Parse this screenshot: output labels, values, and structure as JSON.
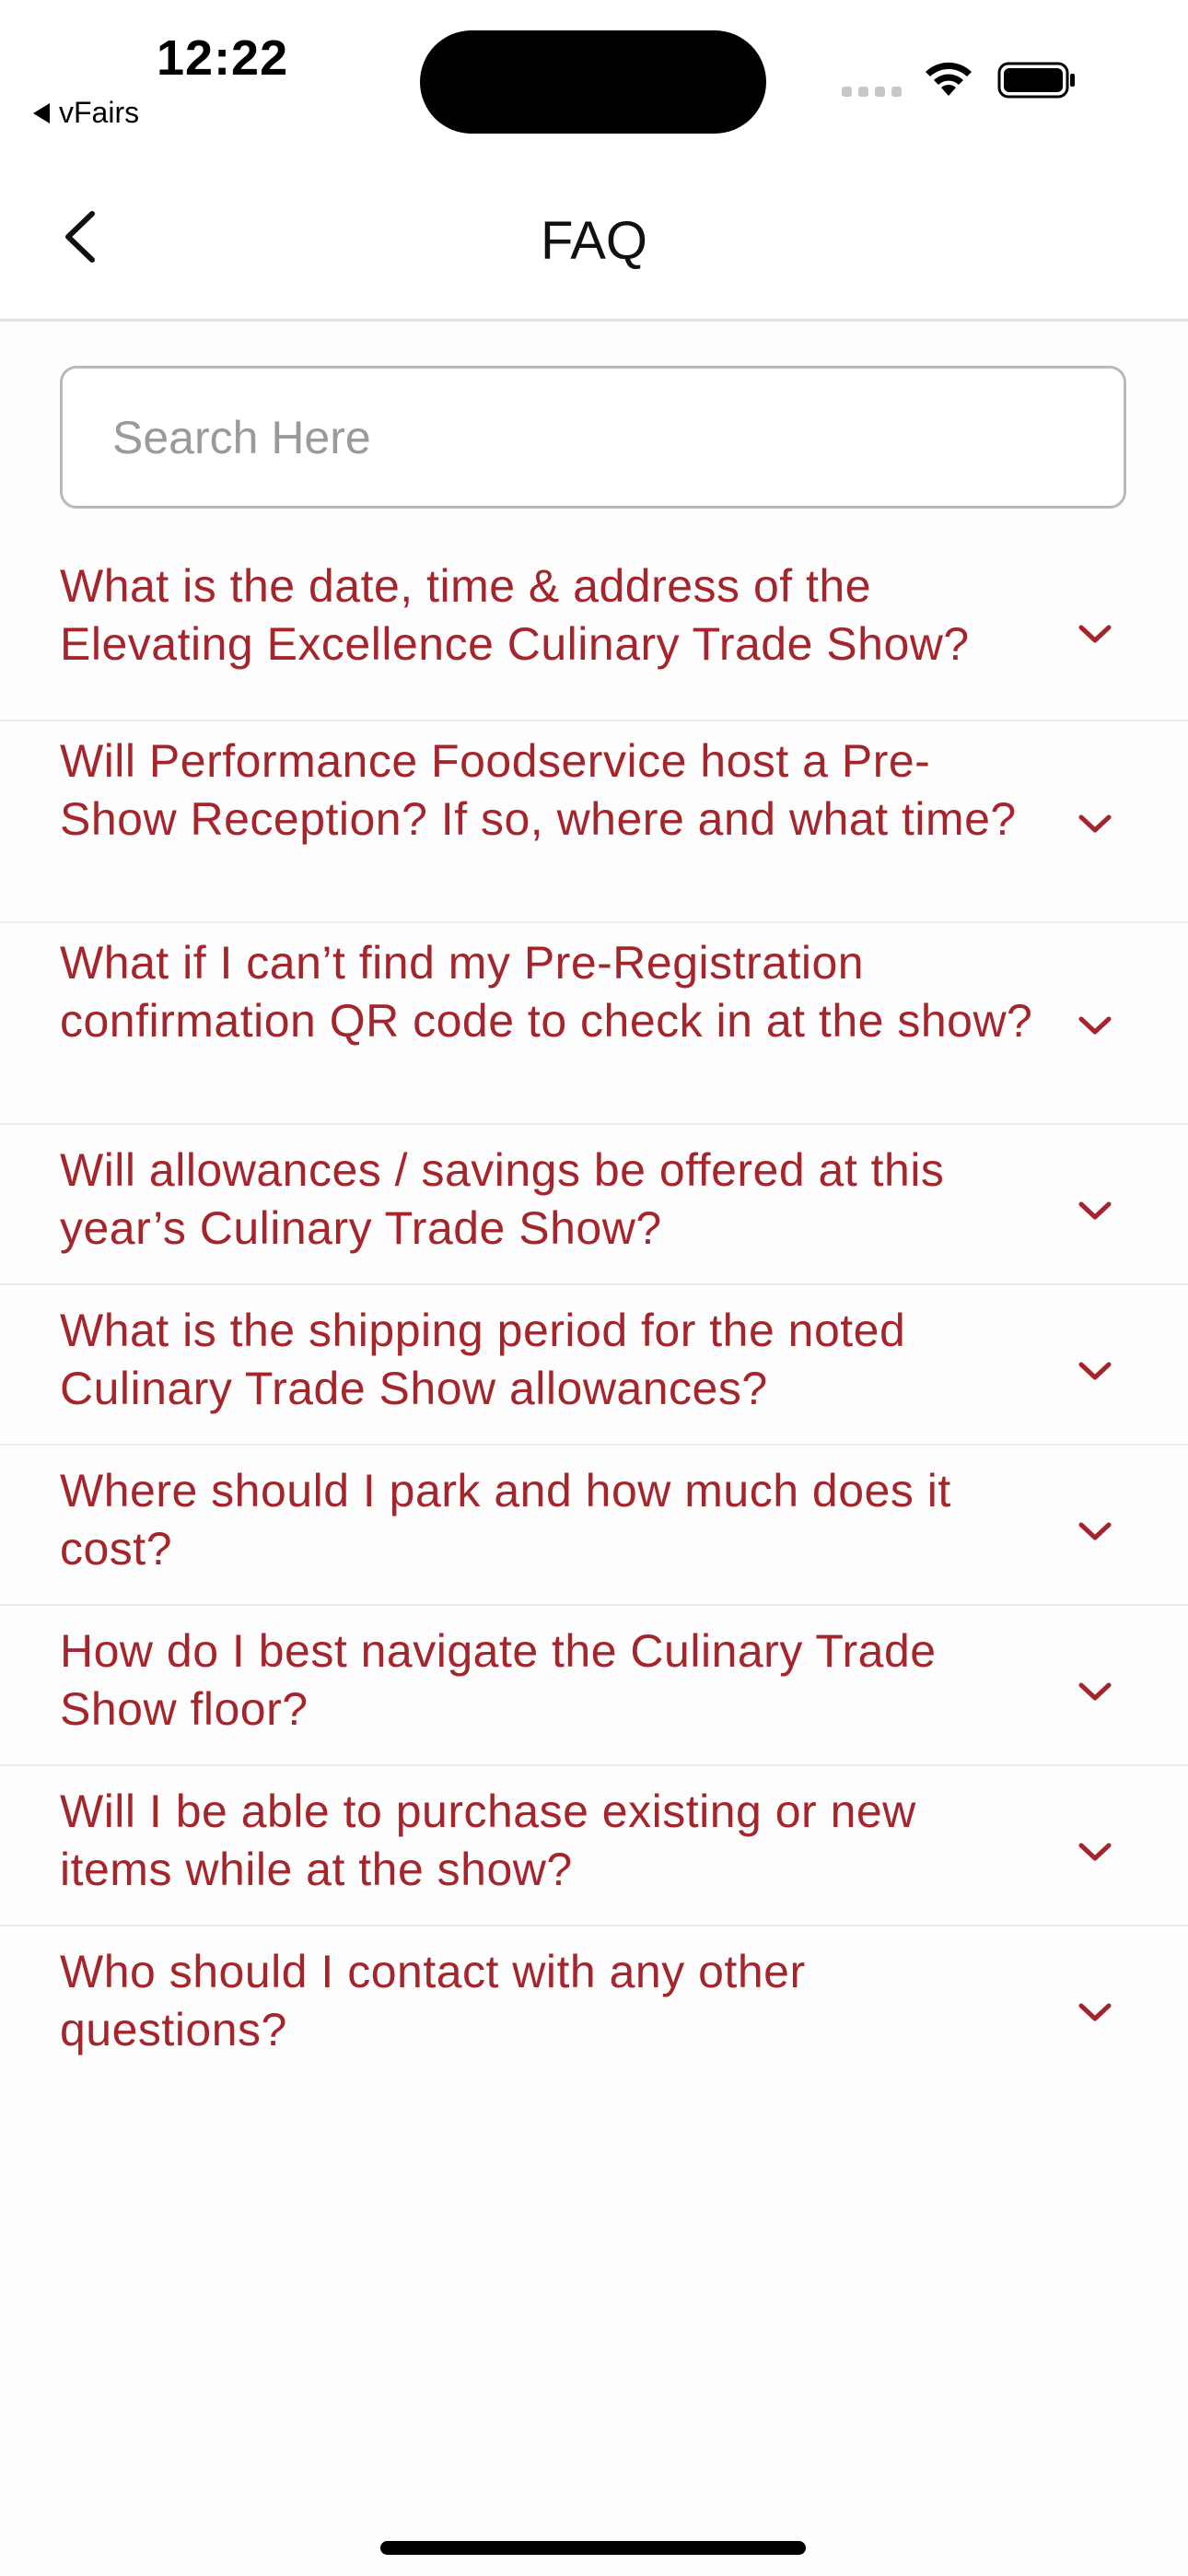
{
  "status_bar": {
    "time": "12:22",
    "back_app_label": "vFairs",
    "icons": [
      "cellular-signal-icon",
      "wifi-icon",
      "battery-icon"
    ]
  },
  "nav": {
    "title": "FAQ",
    "back_icon": "chevron-left-icon"
  },
  "search": {
    "placeholder": "Search Here",
    "value": ""
  },
  "colors": {
    "question_text": "#a4262c",
    "divider": "#ececec"
  },
  "faq": {
    "items": [
      {
        "question": "What is the date, time & address of the Elevating Excellence Culinary Trade Show?",
        "expanded": false
      },
      {
        "question": "Will Performance Foodservice host a Pre-Show Reception?  If so, where and what time?",
        "expanded": false
      },
      {
        "question": "What if I can’t find my Pre-Registration confirmation QR code to check in at the show?",
        "expanded": false
      },
      {
        "question": "Will allowances / savings be offered at this year’s Culinary Trade Show?",
        "expanded": false
      },
      {
        "question": "What is the shipping period for the noted Culinary Trade Show allowances?",
        "expanded": false
      },
      {
        "question": "Where should I park and how much does it cost?",
        "expanded": false
      },
      {
        "question": "How do I best navigate the Culinary Trade Show floor?",
        "expanded": false
      },
      {
        "question": "Will I be able to purchase existing or new items while at the show?",
        "expanded": false
      },
      {
        "question": "Who should I contact with any other questions?",
        "expanded": false
      }
    ]
  }
}
